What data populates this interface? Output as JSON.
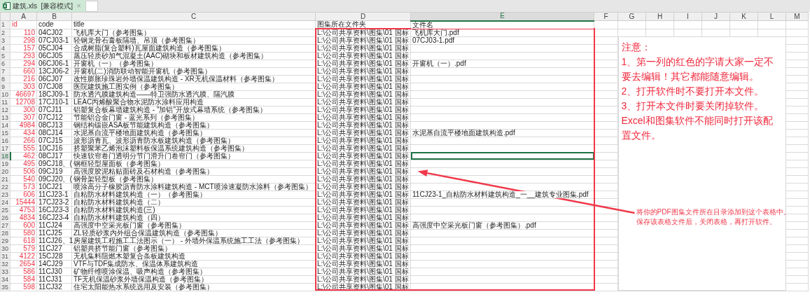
{
  "tab": {
    "title": "建筑.xls  [兼容模式]",
    "close": "×"
  },
  "columns": [
    {
      "label": "A",
      "selected": false
    },
    {
      "label": "B",
      "selected": false
    },
    {
      "label": "C",
      "selected": false
    },
    {
      "label": "D",
      "selected": false
    },
    {
      "label": "E",
      "selected": true
    },
    {
      "label": "F",
      "selected": false
    },
    {
      "label": "G",
      "selected": false
    },
    {
      "label": "H",
      "selected": false
    },
    {
      "label": "I",
      "selected": false
    },
    {
      "label": "J",
      "selected": false
    },
    {
      "label": "K",
      "selected": false
    },
    {
      "label": "L",
      "selected": false
    },
    {
      "label": "M",
      "selected": false
    }
  ],
  "rows": [
    {
      "number": "1",
      "selected": false,
      "id": "id",
      "code": "code",
      "title": "title",
      "folder": "图集所在文件夹",
      "file": "文件名"
    },
    {
      "number": "2",
      "selected": false,
      "id": "110",
      "code": "04CJ02",
      "title": "飞机库大门（参考图集）",
      "folder": "L:\\公司共享资料\\图集\\01 国标",
      "file": "飞机库大门.pdf"
    },
    {
      "number": "3",
      "selected": false,
      "id": "298",
      "code": "07CJ03-1",
      "title": "轻钢龙骨石膏板隔墙、吊顶（参考图集）",
      "folder": "L:\\公司共享资料\\图集\\01 国标",
      "file": "07CJ03-1.pdf"
    },
    {
      "number": "4",
      "selected": false,
      "id": "157",
      "code": "05CJ04",
      "title": "合成树脂(复合塑料)瓦屋面建筑构造（参考图集）",
      "folder": "L:\\公司共享资料\\图集\\01 国标"
    },
    {
      "number": "5",
      "selected": false,
      "id": "293",
      "code": "06CJ05",
      "title": "蒸压轻质砂加气混凝土(AAC)砌块和板材建筑构造（参考图集）",
      "folder": "L:\\公司共享资料\\图集\\01 国标"
    },
    {
      "number": "6",
      "selected": false,
      "id": "294",
      "code": "06CJ06-1",
      "title": "开窗机（一）（参考图集）",
      "folder": "L:\\公司共享资料\\图集\\01 国标",
      "file": "开窗机（一）.pdf"
    },
    {
      "number": "7",
      "selected": false,
      "id": "660",
      "code": "13CJ06-2",
      "title": "开窗机(二)消防联动智能开窗机（参考图集）",
      "folder": "L:\\公司共享资料\\图集\\01 国标"
    },
    {
      "number": "8",
      "selected": false,
      "id": "216",
      "code": "06CJ07",
      "title": "改性膨胀珍珠岩外墙保温建筑构造 - XR无机保温材料（参考图集）",
      "folder": "L:\\公司共享资料\\图集\\01 国标"
    },
    {
      "number": "9",
      "selected": false,
      "id": "303",
      "code": "07CJ08",
      "title": "医院建筑施工图实例（参考图集）",
      "folder": "L:\\公司共享资料\\图集\\01 国标"
    },
    {
      "number": "10",
      "selected": false,
      "id": "46697",
      "code": "18CJ09-1",
      "title": "防水透汽膜建筑构造——特卫强防水透汽膜、隔汽膜",
      "folder": "L:\\公司共享资料\\图集\\01 国标"
    },
    {
      "number": "11",
      "selected": false,
      "id": "12708",
      "code": "17CJ10-1",
      "title": "LEAC丙烯酸聚合物水泥防水涂料应用构造",
      "folder": "L:\\公司共享资料\\图集\\01 国标"
    },
    {
      "number": "12",
      "selected": false,
      "id": "300",
      "code": "07CJ11",
      "title": "铝塑复合板幕墙建筑构造 - \"加铝\"开放式幕墙系统（参考图集）",
      "folder": "L:\\公司共享资料\\图集\\01 国标"
    },
    {
      "number": "13",
      "selected": false,
      "id": "307",
      "code": "07CJ12",
      "title": "节能铝合金门窗 - 蓝光系列（参考图集）",
      "folder": "L:\\公司共享资料\\图集\\01 国标"
    },
    {
      "number": "14",
      "selected": false,
      "id": "4984",
      "code": "08CJ13",
      "title": "钢结构镶嵌ASA板节能建筑构造（参考图集）",
      "folder": "L:\\公司共享资料\\图集\\01 国标"
    },
    {
      "number": "15",
      "selected": false,
      "id": "434",
      "code": "08CJ14",
      "title": "水泥基自流平楼地面建筑构造（参考图集）",
      "folder": "L:\\公司共享资料\\图集\\01 国标",
      "file": "水泥基自流平楼地面建筑构造.pdf"
    },
    {
      "number": "16",
      "selected": false,
      "id": "266",
      "code": "07CJ15",
      "title": "波形沥青瓦、波形沥青防水板建筑构造（参考图集）",
      "folder": "L:\\公司共享资料\\图集\\01 国标"
    },
    {
      "number": "17",
      "selected": false,
      "id": "555",
      "code": "10CJ16",
      "title": "挤塑聚苯乙烯泡沫塑料板保温系统建筑构造（参考图集）",
      "folder": "L:\\公司共享资料\\图集\\01 国标"
    },
    {
      "number": "18",
      "selected": true,
      "id": "462",
      "code": "08CJ17",
      "title": "快速软帘卷门透明分节门滑升门卷帘门（参考图集）",
      "folder": "L:\\公司共享资料\\图集\\01 国标"
    },
    {
      "number": "19",
      "selected": false,
      "id": "495",
      "code": "09CJ18、(",
      "title": "钢框轻型屋面板（参考图集）",
      "folder": "L:\\公司共享资料\\图集\\01 国标"
    },
    {
      "number": "20",
      "selected": false,
      "id": "506",
      "code": "09CJ19",
      "title": "高强度胶泥粘贴面砖及石材构造（参考图集）",
      "folder": "L:\\公司共享资料\\图集\\01 国标"
    },
    {
      "number": "21",
      "selected": false,
      "id": "540",
      "code": "09CJ20、(",
      "title": "钢骨架轻型板（参考图集）",
      "folder": "L:\\公司共享资料\\图集\\01 国标"
    },
    {
      "number": "22",
      "selected": false,
      "id": "573",
      "code": "10CJ21",
      "title": "喷涂高分子橡胶沥青防水涂料建筑构造 - MCT喷涂速凝防水涂料（参考图集）",
      "folder": "L:\\公司共享资料\\图集\\01 国标"
    },
    {
      "number": "23",
      "selected": false,
      "id": "606",
      "code": "11CJ23-1",
      "title": "自粘防水材料建筑构造（一）（参考图集）",
      "folder": "L:\\公司共享资料\\图集\\01 国标",
      "file": "11CJ23-1_自粘防水材料建筑构造_一__建筑专业图集.pdf"
    },
    {
      "number": "24",
      "selected": false,
      "id": "15444",
      "code": "17CJ23-2",
      "title": "自粘防水材料建筑构造（二）",
      "folder": "L:\\公司共享资料\\图集\\01 国标"
    },
    {
      "number": "25",
      "selected": false,
      "id": "4753",
      "code": "16CJ23-3",
      "title": "自粘防水材料建筑构造(三)",
      "folder": "L:\\公司共享资料\\图集\\01 国标"
    },
    {
      "number": "26",
      "selected": false,
      "id": "4834",
      "code": "16CJ23-4",
      "title": "自粘防水材料建筑构造（四）",
      "folder": "L:\\公司共享资料\\图集\\01 国标"
    },
    {
      "number": "27",
      "selected": false,
      "id": "600",
      "code": "11CJ24",
      "title": "高强度中空采光板门窗（参考图集）",
      "folder": "L:\\公司共享资料\\图集\\01 国标",
      "file": "高强度中空采光板门窗（参考图集）.pdf"
    },
    {
      "number": "28",
      "selected": false,
      "id": "580",
      "code": "11CJ25",
      "title": "ZL轻质砂浆内外组合保温建筑构造（参考图集）",
      "folder": "L:\\公司共享资料\\图集\\01 国标"
    },
    {
      "number": "29",
      "selected": false,
      "id": "618",
      "code": "11CJ26、1",
      "title": "房屋建筑工程施工工法图示（一） - 外墙外保温系统施工工法（参考图集）",
      "folder": "L:\\公司共享资料\\图集\\01 国标"
    },
    {
      "number": "30",
      "selected": false,
      "id": "579",
      "code": "11CJ27",
      "title": "铝塑共挤节能门窗（参考图集）",
      "folder": "L:\\公司共享资料\\图集\\01 国标"
    },
    {
      "number": "31",
      "selected": false,
      "id": "4122",
      "code": "15CJ28",
      "title": "无机集料阻燃木塑复合条板建筑构造",
      "folder": "L:\\公司共享资料\\图集\\01 国标"
    },
    {
      "number": "32",
      "selected": false,
      "id": "2654",
      "code": "14CJ29",
      "title": "VTF与TDF集成防水、保温体系建筑构造",
      "folder": "L:\\公司共享资料\\图集\\01 国标"
    },
    {
      "number": "33",
      "selected": false,
      "id": "586",
      "code": "11CJ30",
      "title": "矿物纤维喷涂保温、吸声构造（参考图集）",
      "folder": "L:\\公司共享资料\\图集\\01 国标"
    },
    {
      "number": "34",
      "selected": false,
      "id": "584",
      "code": "11CJ31",
      "title": "TF无机保温砂浆外墙保温构造（参考图集）",
      "folder": "L:\\公司共享资料\\图集\\01 国标"
    },
    {
      "number": "35",
      "selected": false,
      "id": "598",
      "code": "11CJ32",
      "title": "住宅太阳能热水系统选用及安装（参考图集）",
      "folder": "L:\\公司共享资料\\图集\\01 国标"
    }
  ],
  "note": {
    "lines": [
      "注意：",
      "1、第一列的红色的字请大家一定不要去编辑！其它都能随意编辑。",
      "2、打开软件时不要打开本文件。",
      "3、打开本文件时要关闭掉软件。",
      "Excel和图集软件不能同时打开该配置文件。"
    ]
  },
  "callout": {
    "lines": [
      "将你的PDF图集文件所在目录添加到这个表格中。",
      "保存该表格文件后，关闭表格，再打开软件。"
    ]
  }
}
